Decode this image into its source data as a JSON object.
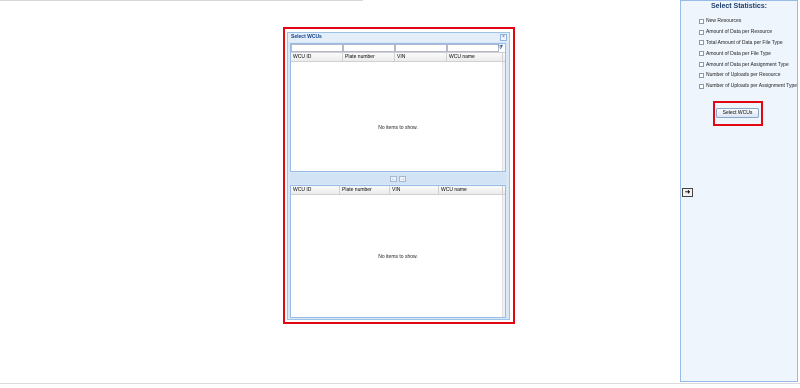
{
  "dialog": {
    "title": "Select WCUs",
    "close_label": "×",
    "filter_icon": "filter-icon",
    "top_grid": {
      "columns": [
        "WCU ID",
        "Plate number",
        "VIN",
        "WCU name"
      ],
      "empty_text": "No items to show."
    },
    "move_buttons": {
      "left_label": "←",
      "right_label": "→"
    },
    "bottom_grid": {
      "columns": [
        "WCU ID",
        "Plate number",
        "VIN",
        "WCU name"
      ],
      "empty_text": "No items to show."
    }
  },
  "panel": {
    "title": "Select Statistics:",
    "options": [
      "New Resources",
      "Amount of Data per Resource",
      "Total Amount of Data per File Type",
      "Amount of Data per File Type",
      "Amount of Data per Assignment Type",
      "Number of Uploads per Resource",
      "Number of Uploads per Assignment Type"
    ],
    "select_button": "Select WCUs",
    "arrow_label": "➜"
  },
  "colors": {
    "highlight": "#e30613",
    "dialog_bg": "#d9e8f7",
    "panel_bg": "#eef5fd"
  }
}
